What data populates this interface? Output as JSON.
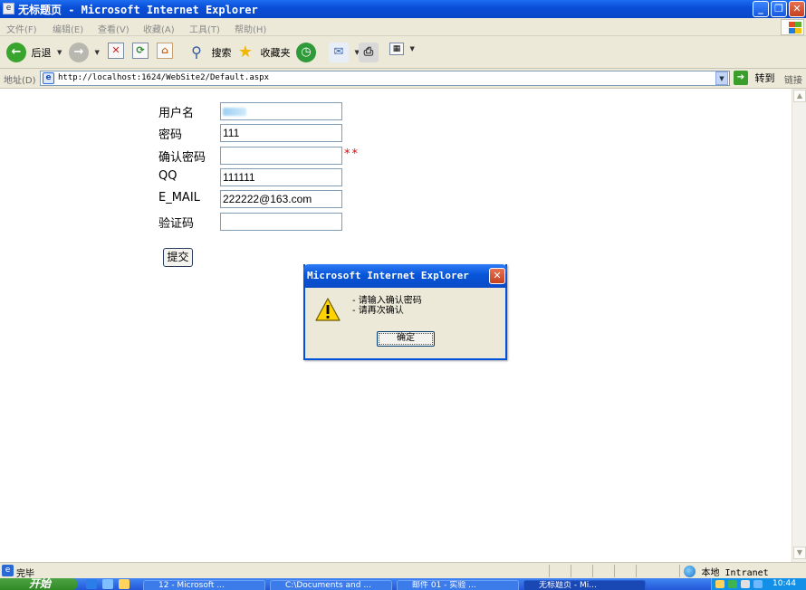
{
  "window": {
    "title": "无标题页 - Microsoft Internet Explorer",
    "minimize_glyph": "_",
    "restore_glyph": "❐",
    "close_glyph": "✕"
  },
  "menu": [
    "文件(F)",
    "编辑(E)",
    "查看(V)",
    "收藏(A)",
    "工具(T)",
    "帮助(H)"
  ],
  "toolbar": {
    "back": "后退",
    "search": "搜索",
    "favorites": "收藏夹"
  },
  "address": {
    "label": "地址(D)",
    "url": "http://localhost:1624/WebSite2/Default.aspx",
    "go": "转到",
    "links": "链接"
  },
  "form": {
    "username": {
      "label": "用户名",
      "value": "⁠"
    },
    "password": {
      "label": "密码",
      "value": "111"
    },
    "confirm_password": {
      "label": "确认密码",
      "value": ""
    },
    "qq": {
      "label": "QQ",
      "value": "111111"
    },
    "email": {
      "label": "E_MAIL",
      "value": "222222@163.com"
    },
    "captcha": {
      "label": "验证码",
      "value": ""
    },
    "required_marker": "**",
    "submit": "提交"
  },
  "dialog": {
    "title": "Microsoft Internet Explorer",
    "line1": "- 请输入确认密码",
    "line2": "- 请再次确认",
    "ok": "确定"
  },
  "status": {
    "text": "完毕",
    "zone": "本地 Intranet"
  },
  "taskbar": {
    "start": "开始",
    "tasks": [
      "12 - Microsoft ...",
      "C:\\Documents and ...",
      "邮件 01 - 实验 ...",
      "无标题页 - Mi..."
    ],
    "clock": "10:44"
  },
  "colors": {
    "title_bar": "#0a4fd8",
    "chrome": "#ece9d8",
    "error_star": "#e00000",
    "input_border": "#7f9db9"
  },
  "icons": [
    "back-icon",
    "forward-icon",
    "stop-icon",
    "refresh-icon",
    "home-icon",
    "search-icon",
    "favorites-star-icon",
    "history-icon",
    "mail-icon",
    "print-icon",
    "edit-icon",
    "page-icon",
    "go-arrow-icon",
    "warning-icon",
    "globe-icon"
  ]
}
